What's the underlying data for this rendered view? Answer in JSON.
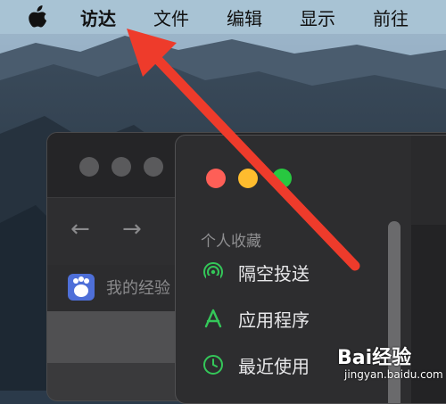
{
  "menubar": {
    "items": [
      "访达",
      "文件",
      "编辑",
      "显示",
      "前往"
    ]
  },
  "back_window": {
    "nav_back": "←",
    "nav_forward": "→",
    "bookmark_text": "我的经验"
  },
  "finder": {
    "section_title": "个人收藏",
    "sidebar": [
      {
        "label": "隔空投送",
        "icon": "airdrop-icon"
      },
      {
        "label": "应用程序",
        "icon": "applications-icon"
      },
      {
        "label": "最近使用",
        "icon": "recents-icon"
      }
    ]
  },
  "watermark": {
    "brand": "Bai经验",
    "site": "jingyan.baidu.com"
  },
  "colors": {
    "menubar": "#a8c3d4",
    "accent_green": "#34c759",
    "arrow_red": "#ee3b2b",
    "traffic_close": "#fe5f57",
    "traffic_minimize": "#febc2e",
    "traffic_zoom": "#28c840"
  }
}
